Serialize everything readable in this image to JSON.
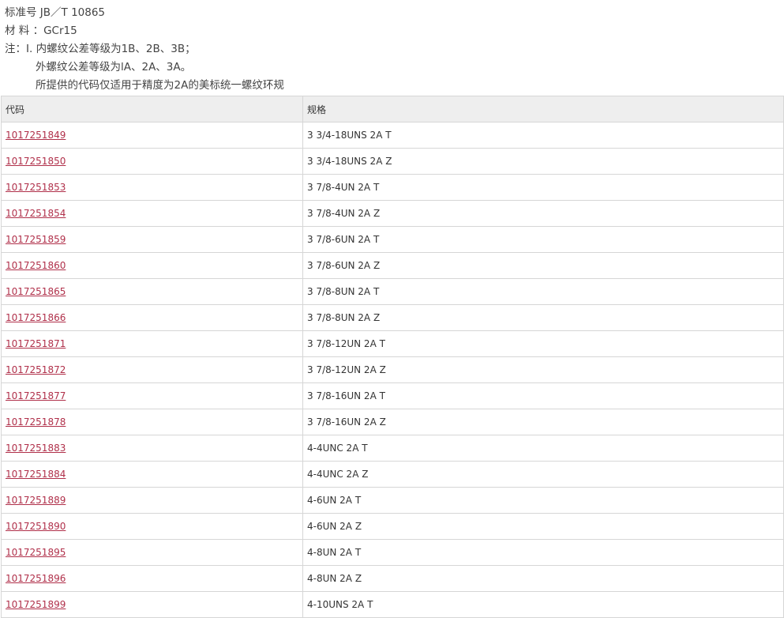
{
  "notes": {
    "standard": "标准号 JB／T 10865",
    "material": "材 料 ：GCr15",
    "note1": "注：I. 内螺纹公差等级为1B、2B、3B；",
    "note2": "外螺纹公差等级为lA、2A、3A。",
    "note3": "所提供的代码仅适用于精度为2A的美标统一螺纹环规"
  },
  "table": {
    "headers": [
      "代码",
      "规格"
    ],
    "rows": [
      {
        "code": "1017251849",
        "spec": "3 3/4-18UNS 2A T"
      },
      {
        "code": "1017251850",
        "spec": "3 3/4-18UNS 2A Z"
      },
      {
        "code": "1017251853",
        "spec": "3 7/8-4UN 2A T"
      },
      {
        "code": "1017251854",
        "spec": "3 7/8-4UN 2A Z"
      },
      {
        "code": "1017251859",
        "spec": "3 7/8-6UN 2A T"
      },
      {
        "code": "1017251860",
        "spec": "3 7/8-6UN 2A Z"
      },
      {
        "code": "1017251865",
        "spec": "3 7/8-8UN 2A T"
      },
      {
        "code": "1017251866",
        "spec": "3 7/8-8UN 2A Z"
      },
      {
        "code": "1017251871",
        "spec": "3 7/8-12UN 2A T"
      },
      {
        "code": "1017251872",
        "spec": "3 7/8-12UN 2A Z"
      },
      {
        "code": "1017251877",
        "spec": "3 7/8-16UN 2A T"
      },
      {
        "code": "1017251878",
        "spec": "3 7/8-16UN 2A Z"
      },
      {
        "code": "1017251883",
        "spec": "4-4UNC 2A T"
      },
      {
        "code": "1017251884",
        "spec": "4-4UNC 2A Z"
      },
      {
        "code": "1017251889",
        "spec": "4-6UN 2A T"
      },
      {
        "code": "1017251890",
        "spec": "4-6UN 2A Z"
      },
      {
        "code": "1017251895",
        "spec": "4-8UN 2A T"
      },
      {
        "code": "1017251896",
        "spec": "4-8UN 2A Z"
      },
      {
        "code": "1017251899",
        "spec": "4-10UNS 2A T"
      }
    ]
  },
  "colors": {
    "link": "#b0304a",
    "header_bg": "#eeeeee",
    "border": "#d6d6d6"
  }
}
